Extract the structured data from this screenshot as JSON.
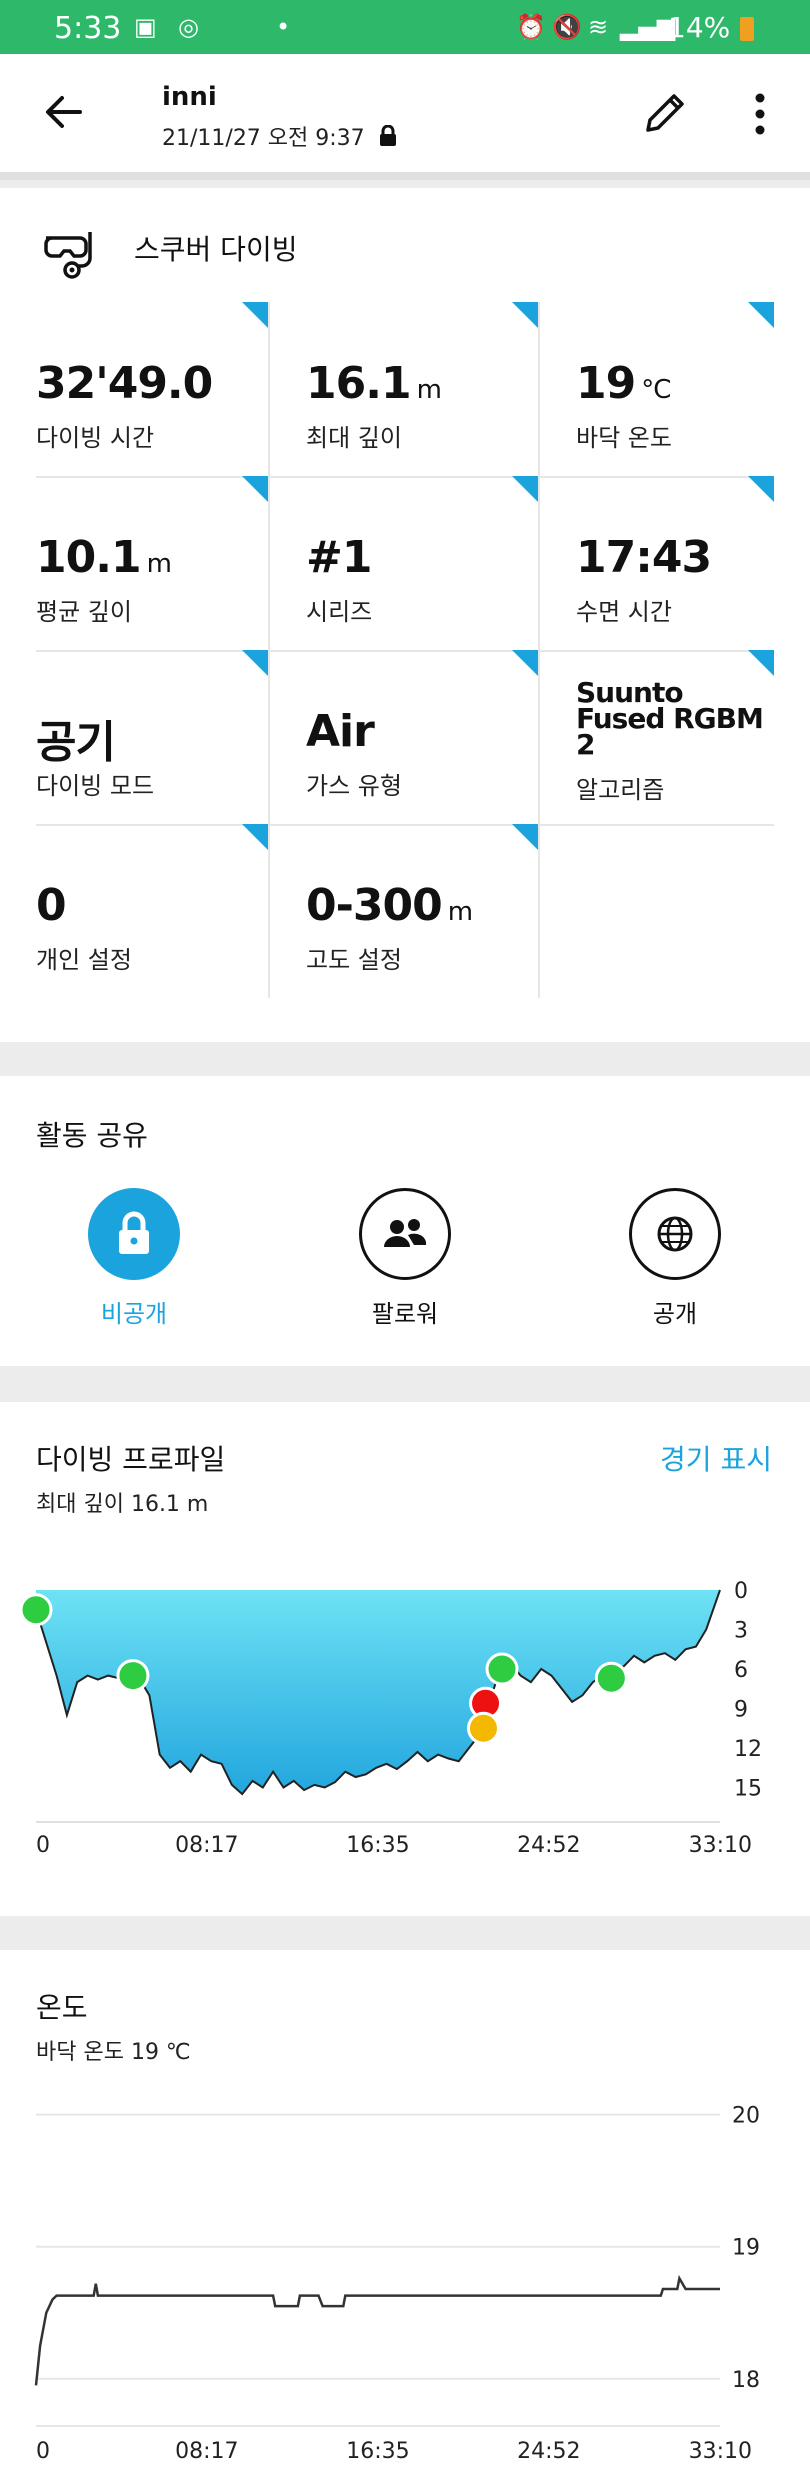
{
  "status_bar": {
    "time": "5:33",
    "battery": "14%"
  },
  "header": {
    "title": "inni",
    "subtitle": "21/11/27 오전 9:37"
  },
  "activity": {
    "name": "스쿠버 다이빙"
  },
  "stats": [
    {
      "value": "32'49.0",
      "unit": "",
      "label": "다이빙 시간"
    },
    {
      "value": "16.1",
      "unit": "m",
      "label": "최대 깊이"
    },
    {
      "value": "19",
      "unit": "°C",
      "label": "바닥 온도"
    },
    {
      "value": "10.1",
      "unit": "m",
      "label": "평균 깊이"
    },
    {
      "value": "#1",
      "unit": "",
      "label": "시리즈"
    },
    {
      "value": "17:43",
      "unit": "",
      "label": "수면 시간"
    },
    {
      "value": "공기",
      "unit": "",
      "label": "다이빙 모드"
    },
    {
      "value": "Air",
      "unit": "",
      "label": "가스 유형"
    },
    {
      "value": "Suunto Fused RGBM 2",
      "unit": "",
      "label": "알고리즘"
    },
    {
      "value": "0",
      "unit": "",
      "label": "개인 설정"
    },
    {
      "value": "0-300",
      "unit": "m",
      "label": "고도 설정"
    }
  ],
  "share": {
    "title": "활동 공유",
    "options": [
      {
        "label": "비공개",
        "icon": "lock-icon",
        "selected": true
      },
      {
        "label": "팔로워",
        "icon": "followers-icon",
        "selected": false
      },
      {
        "label": "공개",
        "icon": "globe-icon",
        "selected": false
      }
    ]
  },
  "dive_profile": {
    "title": "다이빙 프로파일",
    "link": "경기 표시",
    "subtitle": "최대 깊이 16.1 m"
  },
  "temperature": {
    "title": "온도",
    "subtitle": "바닥 온도 19 ℃"
  },
  "colors": {
    "accent": "#1aa3dc",
    "status_bar": "#2db86a",
    "green_marker": "#2ecc40",
    "red_marker": "#ee1111",
    "yellow_marker": "#f5b800"
  },
  "chart_data": [
    {
      "type": "area",
      "x_ticks": [
        "0",
        "08:17",
        "16:35",
        "24:52",
        "33:10"
      ],
      "y_ticks": [
        "0",
        "3",
        "6",
        "9",
        "12",
        "15"
      ],
      "xlim": [
        0,
        33.17
      ],
      "ylim": [
        0,
        16.1
      ],
      "y_inverted": true,
      "x": [
        0,
        0.5,
        1.0,
        1.5,
        2.0,
        2.5,
        3.0,
        3.5,
        4.0,
        4.5,
        5.0,
        5.5,
        6.0,
        6.5,
        7.0,
        7.5,
        8.0,
        8.5,
        9.0,
        9.5,
        10.0,
        10.5,
        11.0,
        11.5,
        12.0,
        12.5,
        13.0,
        13.5,
        14.0,
        14.5,
        15.0,
        15.5,
        16.0,
        16.5,
        17.0,
        17.5,
        18.0,
        18.5,
        19.0,
        19.5,
        20.0,
        20.5,
        21.0,
        21.5,
        22.0,
        22.5,
        23.0,
        23.5,
        24.0,
        24.5,
        25.0,
        25.5,
        26.0,
        26.5,
        27.0,
        27.5,
        28.0,
        28.5,
        29.0,
        29.5,
        30.0,
        30.5,
        31.0,
        31.5,
        32.0,
        32.5,
        33.17
      ],
      "values": [
        1.5,
        4.0,
        6.5,
        9.5,
        7.0,
        6.5,
        6.8,
        6.5,
        6.7,
        6.3,
        6.7,
        8.0,
        12.5,
        13.5,
        13.0,
        13.8,
        12.5,
        13.0,
        13.2,
        14.8,
        15.5,
        14.5,
        15.0,
        13.8,
        15.0,
        14.5,
        15.2,
        14.8,
        15.0,
        14.6,
        13.8,
        14.2,
        14.0,
        13.5,
        13.2,
        13.6,
        13.0,
        12.3,
        13.0,
        12.5,
        12.8,
        13.0,
        12.0,
        11.0,
        8.5,
        6.0,
        5.5,
        6.5,
        7.0,
        6.0,
        6.5,
        7.5,
        8.5,
        8.0,
        7.0,
        6.5,
        6.0,
        5.8,
        5.0,
        5.5,
        5.0,
        4.8,
        5.3,
        4.5,
        4.3,
        3.0,
        0
      ],
      "markers": [
        {
          "x": 0,
          "y": 1.5,
          "color": "green"
        },
        {
          "x": 4.7,
          "y": 6.5,
          "color": "green"
        },
        {
          "x": 22.6,
          "y": 6.0,
          "color": "green"
        },
        {
          "x": 27.9,
          "y": 6.7,
          "color": "green"
        },
        {
          "x": 21.8,
          "y": 8.6,
          "color": "red"
        },
        {
          "x": 21.7,
          "y": 10.5,
          "color": "yellow"
        }
      ]
    },
    {
      "type": "line",
      "x_ticks": [
        "0",
        "08:17",
        "16:35",
        "24:52",
        "33:10"
      ],
      "y_ticks": [
        "20",
        "19",
        "18"
      ],
      "xlim": [
        0,
        33.17
      ],
      "ylim": [
        17.9,
        20.05
      ],
      "x": [
        0,
        0.2,
        0.5,
        0.8,
        1.0,
        2.8,
        2.9,
        3.0,
        3.2,
        11.5,
        11.6,
        12.7,
        12.8,
        13.0,
        13.7,
        13.9,
        14.0,
        14.9,
        15.0,
        30.3,
        30.4,
        31.1,
        31.2,
        31.5,
        31.6,
        33.17
      ],
      "values": [
        17.95,
        18.25,
        18.5,
        18.6,
        18.63,
        18.63,
        18.72,
        18.63,
        18.63,
        18.63,
        18.55,
        18.55,
        18.63,
        18.63,
        18.63,
        18.55,
        18.55,
        18.55,
        18.63,
        18.63,
        18.68,
        18.68,
        18.76,
        18.68,
        18.68,
        18.68
      ]
    }
  ]
}
